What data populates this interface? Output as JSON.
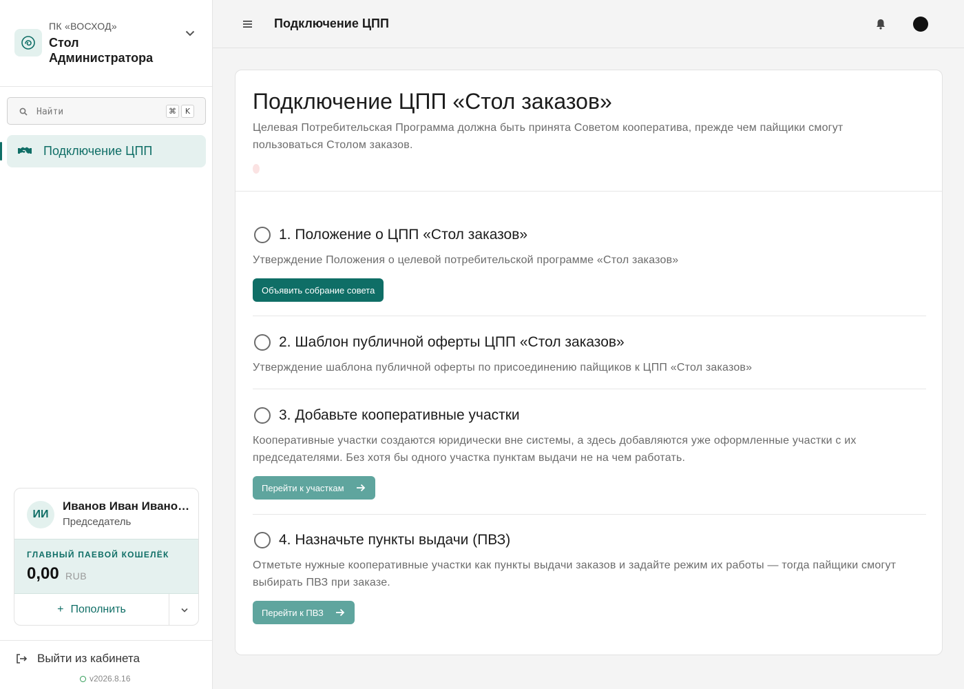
{
  "sidebar": {
    "org_small": "ПК «ВОСХОД»",
    "org_name": "Стол Администратора",
    "search_placeholder": "Найти",
    "shortcut_cmd": "⌘",
    "shortcut_key": "K",
    "nav": [
      {
        "label": "Подключение ЦПП",
        "icon": "handshake-icon",
        "active": true
      }
    ],
    "user": {
      "initials": "ИИ",
      "name": "Иванов Иван Иванович",
      "role": "Председатель"
    },
    "wallet": {
      "label": "ГЛАВНЫЙ ПАЕВОЙ КОШЕЛЁК",
      "amount": "0,00",
      "currency": "RUB"
    },
    "topup_label": "Пополнить",
    "logout_label": "Выйти из кабинета",
    "version": "v2026.8.16"
  },
  "header": {
    "title": "Подключение ЦПП"
  },
  "main": {
    "title": "Подключение ЦПП «Стол заказов»",
    "subtitle": "Целевая Потребительская Программа должна быть принята Советом кооператива, прежде чем пайщики смогут пользоваться Столом заказов.",
    "steps": [
      {
        "title": "1. Положение о ЦПП «Стол заказов»",
        "description": "Утверждение Положения о целевой потребительской программе «Стол заказов»",
        "button": "Объявить собрание совета"
      },
      {
        "title": "2. Шаблон публичной оферты ЦПП «Стол заказов»",
        "description": "Утверждение шаблона публичной оферты по присоединению пайщиков к ЦПП «Стол заказов»",
        "button": ""
      },
      {
        "title": "3. Добавьте кооперативные участки",
        "description": "Кооперативные участки создаются юридически вне системы, а здесь добавляются уже оформленные участки с их председателями. Без хотя бы одного участка пунктам выдачи не на чем работать.",
        "button": "Перейти к участкам"
      },
      {
        "title": "4. Назначьте пункты выдачи (ПВЗ)",
        "description": "Отметьте нужные кооперативные участки как пункты выдачи заказов и задайте режим их работы — тогда пайщики смогут выбирать ПВЗ при заказе.",
        "button": "Перейти к ПВЗ"
      }
    ]
  },
  "colors": {
    "accent": "#0f6e66",
    "accent_muted": "#5fa59e",
    "accent_bg": "#e5f1ef"
  }
}
